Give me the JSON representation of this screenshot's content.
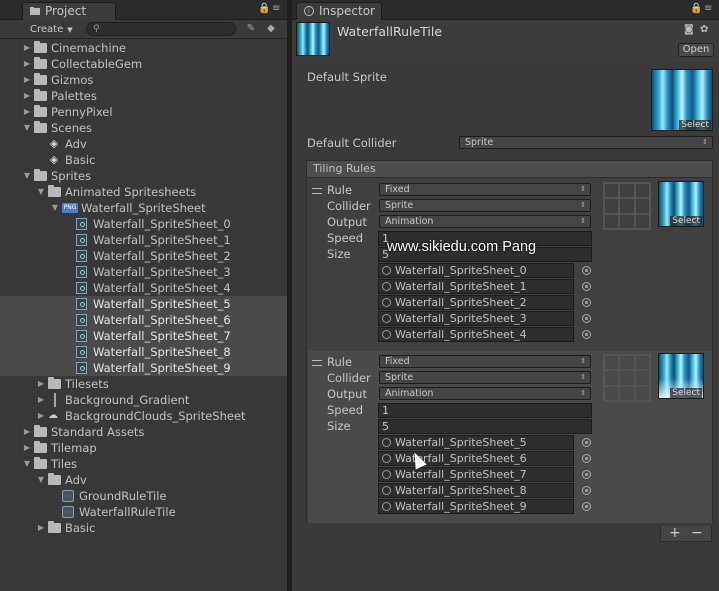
{
  "project": {
    "tab_title": "Project",
    "create_label": "Create",
    "search_placeholder": "",
    "tree": [
      {
        "label": "Cinemachine",
        "depth": 0,
        "icon": "folder-icon",
        "expand": "collapsed"
      },
      {
        "label": "CollectableGem",
        "depth": 0,
        "icon": "folder-icon",
        "expand": "collapsed"
      },
      {
        "label": "Gizmos",
        "depth": 0,
        "icon": "folder-icon",
        "expand": "collapsed"
      },
      {
        "label": "Palettes",
        "depth": 0,
        "icon": "folder-icon",
        "expand": "collapsed"
      },
      {
        "label": "PennyPixel",
        "depth": 0,
        "icon": "folder-icon",
        "expand": "collapsed"
      },
      {
        "label": "Scenes",
        "depth": 0,
        "icon": "folder-icon",
        "expand": "expanded"
      },
      {
        "label": "Adv",
        "depth": 1,
        "icon": "unity-scene-icon",
        "expand": "none"
      },
      {
        "label": "Basic",
        "depth": 1,
        "icon": "unity-scene-icon",
        "expand": "none"
      },
      {
        "label": "Sprites",
        "depth": 0,
        "icon": "folder-icon",
        "expand": "expanded"
      },
      {
        "label": "Animated Spritesheets",
        "depth": 1,
        "icon": "folder-icon",
        "expand": "expanded"
      },
      {
        "label": "Waterfall_SpriteSheet",
        "depth": 2,
        "icon": "png-texture-icon",
        "expand": "expanded"
      },
      {
        "label": "Waterfall_SpriteSheet_0",
        "depth": 3,
        "icon": "sprite-icon",
        "expand": "none",
        "selected": false
      },
      {
        "label": "Waterfall_SpriteSheet_1",
        "depth": 3,
        "icon": "sprite-icon",
        "expand": "none",
        "selected": false
      },
      {
        "label": "Waterfall_SpriteSheet_2",
        "depth": 3,
        "icon": "sprite-icon",
        "expand": "none",
        "selected": false
      },
      {
        "label": "Waterfall_SpriteSheet_3",
        "depth": 3,
        "icon": "sprite-icon",
        "expand": "none",
        "selected": false
      },
      {
        "label": "Waterfall_SpriteSheet_4",
        "depth": 3,
        "icon": "sprite-icon",
        "expand": "none",
        "selected": false
      },
      {
        "label": "Waterfall_SpriteSheet_5",
        "depth": 3,
        "icon": "sprite-icon",
        "expand": "none",
        "selected": true
      },
      {
        "label": "Waterfall_SpriteSheet_6",
        "depth": 3,
        "icon": "sprite-icon",
        "expand": "none",
        "selected": true
      },
      {
        "label": "Waterfall_SpriteSheet_7",
        "depth": 3,
        "icon": "sprite-icon",
        "expand": "none",
        "selected": true
      },
      {
        "label": "Waterfall_SpriteSheet_8",
        "depth": 3,
        "icon": "sprite-icon",
        "expand": "none",
        "selected": true
      },
      {
        "label": "Waterfall_SpriteSheet_9",
        "depth": 3,
        "icon": "sprite-icon",
        "expand": "none",
        "selected": true
      },
      {
        "label": "Tilesets",
        "depth": 1,
        "icon": "folder-icon",
        "expand": "collapsed"
      },
      {
        "label": "Background_Gradient",
        "depth": 1,
        "icon": "gradient-texture-icon",
        "expand": "collapsed"
      },
      {
        "label": "BackgroundClouds_SpriteSheet",
        "depth": 1,
        "icon": "cloud-texture-icon",
        "expand": "collapsed"
      },
      {
        "label": "Standard Assets",
        "depth": 0,
        "icon": "folder-icon",
        "expand": "collapsed"
      },
      {
        "label": "Tilemap",
        "depth": 0,
        "icon": "folder-icon",
        "expand": "collapsed"
      },
      {
        "label": "Tiles",
        "depth": 0,
        "icon": "folder-icon",
        "expand": "expanded"
      },
      {
        "label": "Adv",
        "depth": 1,
        "icon": "folder-icon",
        "expand": "expanded"
      },
      {
        "label": "GroundRuleTile",
        "depth": 2,
        "icon": "rule-tile-icon",
        "expand": "none"
      },
      {
        "label": "WaterfallRuleTile",
        "depth": 2,
        "icon": "rule-tile-icon",
        "expand": "none"
      },
      {
        "label": "Basic",
        "depth": 1,
        "icon": "folder-icon",
        "expand": "collapsed"
      }
    ]
  },
  "inspector": {
    "tab_title": "Inspector",
    "asset_name": "WaterfallRuleTile",
    "open_label": "Open",
    "default_sprite_label": "Default Sprite",
    "select_label": "Select",
    "default_collider_label": "Default Collider",
    "default_collider_value": "Sprite",
    "tiling_rules_label": "Tiling Rules",
    "rules": [
      {
        "rule_label": "Rule",
        "rule_value": "Fixed",
        "collider_label": "Collider",
        "collider_value": "Sprite",
        "output_label": "Output",
        "output_value": "Animation",
        "speed_label": "Speed",
        "speed_value": "1",
        "size_label": "Size",
        "size_value": "5",
        "sprites": [
          "Waterfall_SpriteSheet_0",
          "Waterfall_SpriteSheet_1",
          "Waterfall_SpriteSheet_2",
          "Waterfall_SpriteSheet_3",
          "Waterfall_SpriteSheet_4"
        ]
      },
      {
        "rule_label": "Rule",
        "rule_value": "Fixed",
        "collider_label": "Collider",
        "collider_value": "Sprite",
        "output_label": "Output",
        "output_value": "Animation",
        "speed_label": "Speed",
        "speed_value": "1",
        "size_label": "Size",
        "size_value": "5",
        "sprites": [
          "Waterfall_SpriteSheet_5",
          "Waterfall_SpriteSheet_6",
          "Waterfall_SpriteSheet_7",
          "Waterfall_SpriteSheet_8",
          "Waterfall_SpriteSheet_9"
        ]
      }
    ],
    "add_symbol": "+",
    "remove_symbol": "−"
  },
  "watermark": "www.sikiedu.com Pang",
  "colors": {
    "panel_bg": "#383838",
    "selection": "#4a4a4a",
    "accent_water": "#3bb0d6"
  }
}
